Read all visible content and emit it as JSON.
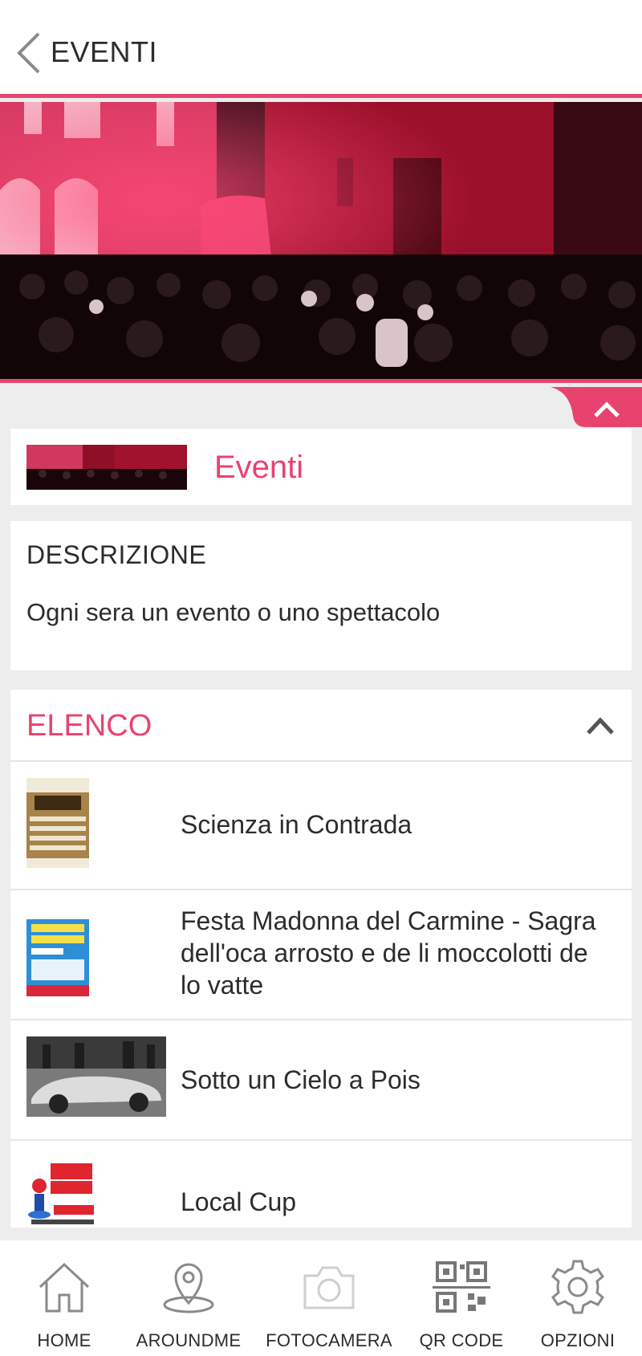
{
  "header": {
    "title": "EVENTI",
    "back_icon": "chevron-left-icon"
  },
  "colors": {
    "accent": "#e8436f",
    "text": "#2c2c2c",
    "background": "#ededed"
  },
  "title_card": {
    "title": "Eventi"
  },
  "description": {
    "heading": "DESCRIZIONE",
    "text": "Ogni sera un evento o uno spettacolo"
  },
  "list": {
    "heading": "ELENCO",
    "items": [
      {
        "label": "Scienza in Contrada"
      },
      {
        "label": "Festa Madonna del Carmine - Sagra dell'oca arrosto e de li moccolotti de lo vatte"
      },
      {
        "label": "Sotto un Cielo a Pois"
      },
      {
        "label": "Local Cup"
      }
    ]
  },
  "tabbar": {
    "tabs": [
      {
        "label": "HOME",
        "icon": "home-icon"
      },
      {
        "label": "AROUNDME",
        "icon": "location-pin-icon"
      },
      {
        "label": "FOTOCAMERA",
        "icon": "camera-icon"
      },
      {
        "label": "QR CODE",
        "icon": "qr-code-icon"
      },
      {
        "label": "OPZIONI",
        "icon": "gear-icon"
      }
    ]
  }
}
